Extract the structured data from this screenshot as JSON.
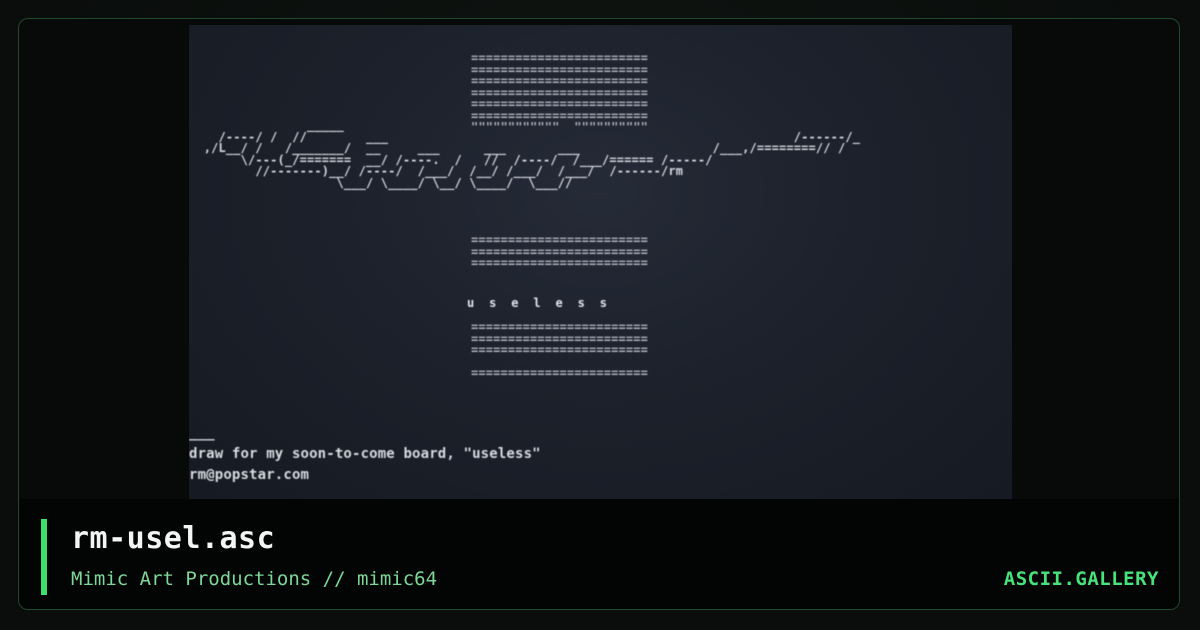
{
  "artwork": {
    "dots_top": "========================\n========================\n========================\n========================\n========================\n========================\n\"\"\"\"\"\"\"\"\"\"\"\"  \"\"\"\"\"\"\"\"\"\"",
    "logo": "                _____\n    /----/ /  //        ___                                                       /------/_\n  ,/L__/ /   /_______/  __     ___      ___       ___                  /___,/========// /\n       \\/---(_/=======  __/ /----.  /   //  /----/  /___/====== /-----/\n         //-------)__/ /----/  /___/  /__/ /___/  /___/  /------/rm\n                    \\___/ \\____/ \\__/ \\____/  \\___//",
    "dots_bottom": "========================\n========================\n========================",
    "letters": "u  s  e  l  e  s  s",
    "dots_bottom2": "========================\n========================\n========================\n\n========================",
    "footer_lines": "___\ndraw for my soon-to-come board, \"useless\"\nrm@popstar.com"
  },
  "footer": {
    "title": "rm-usel.asc",
    "subtitle": "Mimic Art Productions // mimic64",
    "brand": "ASCII.GALLERY"
  },
  "colors": {
    "accent": "#3ee06a",
    "brand": "#48e27a",
    "subtitle": "#7fd699",
    "border": "#1f4a2c"
  }
}
